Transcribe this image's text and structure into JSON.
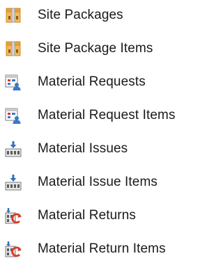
{
  "nav": {
    "items": [
      {
        "label": "Site Packages",
        "icon": "package-icon"
      },
      {
        "label": "Site Package Items",
        "icon": "package-icon"
      },
      {
        "label": "Material Requests",
        "icon": "material-request-icon"
      },
      {
        "label": "Material Request Items",
        "icon": "material-request-icon"
      },
      {
        "label": "Material Issues",
        "icon": "material-issue-icon"
      },
      {
        "label": "Material Issue Items",
        "icon": "material-issue-icon"
      },
      {
        "label": "Material Returns",
        "icon": "material-return-icon"
      },
      {
        "label": "Material Return Items",
        "icon": "material-return-icon"
      }
    ]
  },
  "colors": {
    "text": "#1a1a1a",
    "package_orange": "#e8a13c",
    "request_blue": "#3a78c8",
    "request_red": "#d9362b",
    "issue_blue": "#2f6fbf",
    "return_red": "#d93a2a"
  }
}
